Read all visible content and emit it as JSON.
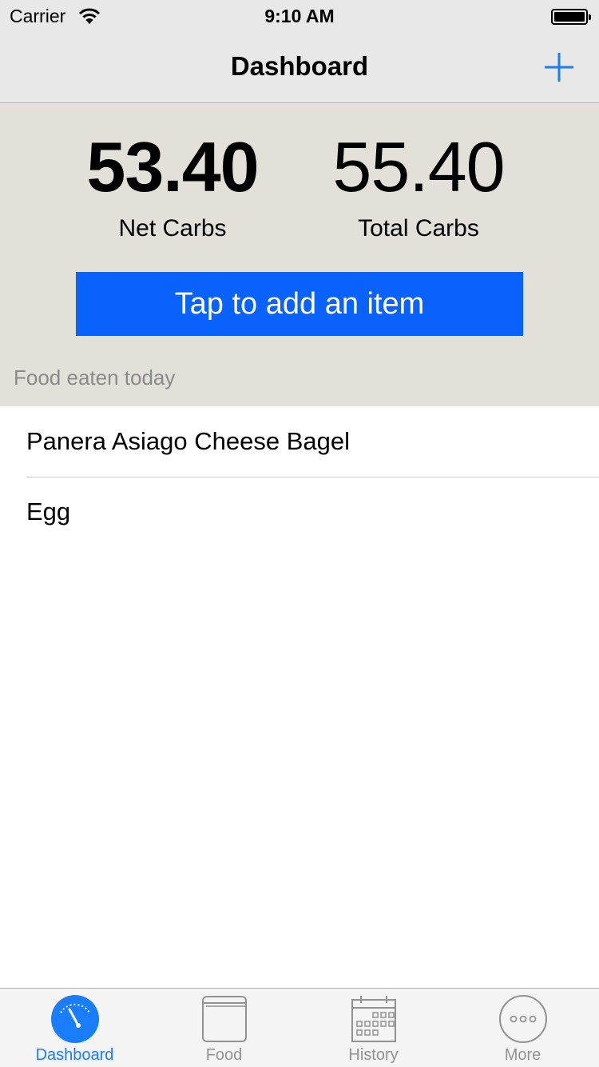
{
  "status_bar": {
    "carrier": "Carrier",
    "time": "9:10 AM"
  },
  "nav": {
    "title": "Dashboard"
  },
  "summary": {
    "net_value": "53.40",
    "net_label": "Net Carbs",
    "total_value": "55.40",
    "total_label": "Total Carbs",
    "cta_label": "Tap to add an item"
  },
  "food_list": {
    "header": "Food eaten today",
    "items": [
      {
        "name": "Panera Asiago Cheese Bagel"
      },
      {
        "name": "Egg"
      }
    ]
  },
  "tabbar": {
    "tabs": [
      {
        "label": "Dashboard",
        "icon": "gauge-icon",
        "active": true
      },
      {
        "label": "Food",
        "icon": "book-icon",
        "active": false
      },
      {
        "label": "History",
        "icon": "calendar-icon",
        "active": false
      },
      {
        "label": "More",
        "icon": "more-icon",
        "active": false
      }
    ]
  },
  "colors": {
    "accent": "#1a7dfb",
    "cta_background": "#0a62fd",
    "summary_background": "#e3dfd9",
    "bar_background": "#e8e8e8"
  }
}
